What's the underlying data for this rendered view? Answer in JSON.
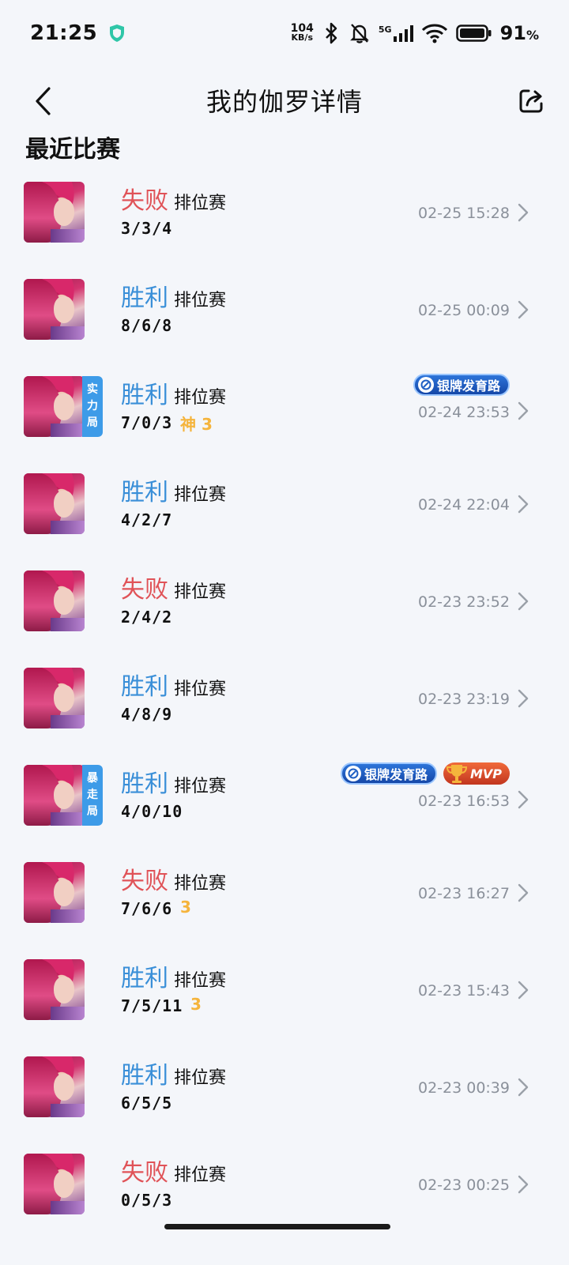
{
  "status_bar": {
    "time": "21:25",
    "net_speed_value": "104",
    "net_speed_unit": "KB/s",
    "network_type": "5G",
    "battery_percent": "91",
    "battery_unit": "%"
  },
  "header": {
    "title": "我的伽罗详情"
  },
  "section": {
    "title": "最近比赛"
  },
  "matches": [
    {
      "result": "失败",
      "result_type": "loss",
      "mode": "排位赛",
      "kda": "3/3/4",
      "datetime": "02-25 15:28"
    },
    {
      "result": "胜利",
      "result_type": "win",
      "mode": "排位赛",
      "kda": "8/6/8",
      "datetime": "02-25 00:09"
    },
    {
      "result": "胜利",
      "result_type": "win",
      "mode": "排位赛",
      "kda": "7/0/3",
      "extra": "神 3",
      "tag": [
        "实",
        "力",
        "局"
      ],
      "badges": {
        "lane": "银牌发育路"
      },
      "datetime": "02-24 23:53"
    },
    {
      "result": "胜利",
      "result_type": "win",
      "mode": "排位赛",
      "kda": "4/2/7",
      "datetime": "02-24 22:04"
    },
    {
      "result": "失败",
      "result_type": "loss",
      "mode": "排位赛",
      "kda": "2/4/2",
      "datetime": "02-23 23:52"
    },
    {
      "result": "胜利",
      "result_type": "win",
      "mode": "排位赛",
      "kda": "4/8/9",
      "datetime": "02-23 23:19"
    },
    {
      "result": "胜利",
      "result_type": "win",
      "mode": "排位赛",
      "kda": "4/0/10",
      "tag": [
        "暴",
        "走",
        "局"
      ],
      "badges": {
        "lane": "银牌发育路",
        "mvp": "MVP"
      },
      "datetime": "02-23 16:53"
    },
    {
      "result": "失败",
      "result_type": "loss",
      "mode": "排位赛",
      "kda": "7/6/6",
      "extra": "3",
      "datetime": "02-23 16:27"
    },
    {
      "result": "胜利",
      "result_type": "win",
      "mode": "排位赛",
      "kda": "7/5/11",
      "extra": "3",
      "datetime": "02-23 15:43"
    },
    {
      "result": "胜利",
      "result_type": "win",
      "mode": "排位赛",
      "kda": "6/5/5",
      "datetime": "02-23 00:39"
    },
    {
      "result": "失败",
      "result_type": "loss",
      "mode": "排位赛",
      "kda": "0/5/3",
      "datetime": "02-23 00:25"
    }
  ],
  "colors": {
    "win": "#3a8fd8",
    "loss": "#e05358",
    "extra": "#f5b43c",
    "tag": "#3d9be8"
  }
}
